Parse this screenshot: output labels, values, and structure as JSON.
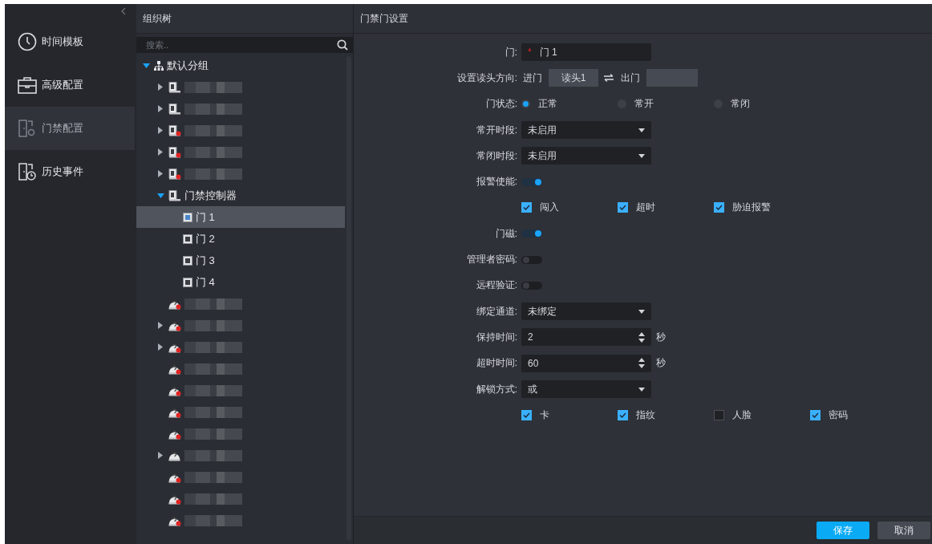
{
  "nav": {
    "items": [
      {
        "label": "时间模板",
        "selected": false
      },
      {
        "label": "高级配置",
        "selected": false
      },
      {
        "label": "门禁配置",
        "selected": true
      },
      {
        "label": "历史事件",
        "selected": false
      }
    ]
  },
  "tree": {
    "title": "组织树",
    "search": {
      "placeholder": "搜索.."
    },
    "root": {
      "label": "默认分组",
      "expanded": true,
      "children": [
        {
          "kind": "device",
          "expanded": false,
          "alarm": false
        },
        {
          "kind": "device",
          "expanded": false,
          "alarm": false
        },
        {
          "kind": "device",
          "expanded": false,
          "alarm": true
        },
        {
          "kind": "device",
          "expanded": false,
          "alarm": true
        },
        {
          "kind": "device",
          "expanded": false,
          "alarm": true
        },
        {
          "kind": "device",
          "label": "门禁控制器",
          "expanded": true,
          "alarm": false,
          "children": [
            {
              "kind": "door",
              "label": "门 1",
              "selected": true
            },
            {
              "kind": "door",
              "label": "门 2",
              "selected": false
            },
            {
              "kind": "door",
              "label": "门 3",
              "selected": false
            },
            {
              "kind": "door",
              "label": "门 4",
              "selected": false
            }
          ]
        },
        {
          "kind": "offline",
          "alarm": true
        },
        {
          "kind": "offline",
          "expanded": false,
          "alarm": true
        },
        {
          "kind": "offline",
          "expanded": false,
          "alarm": true
        },
        {
          "kind": "offline",
          "alarm": true
        },
        {
          "kind": "offline",
          "alarm": true
        },
        {
          "kind": "offline",
          "alarm": true
        },
        {
          "kind": "offline",
          "alarm": true
        },
        {
          "kind": "offline",
          "expanded": false,
          "alarm": false
        },
        {
          "kind": "offline",
          "alarm": true
        },
        {
          "kind": "offline",
          "alarm": true
        },
        {
          "kind": "offline",
          "alarm": true
        }
      ]
    }
  },
  "form": {
    "title": "门禁门设置",
    "rows": [
      {
        "kind": "text",
        "label": "门:",
        "required_mark": "*",
        "value": "门 1"
      },
      {
        "kind": "direction",
        "label": "设置读头方向:",
        "in_label": "进门",
        "in_value": "读头1",
        "out_label": "出门"
      },
      {
        "kind": "radio",
        "label": "门状态:",
        "options": [
          {
            "label": "正常",
            "selected": true
          },
          {
            "label": "常开",
            "selected": false
          },
          {
            "label": "常闭",
            "selected": false
          }
        ]
      },
      {
        "kind": "select",
        "label": "常开时段:",
        "value": "未启用"
      },
      {
        "kind": "select",
        "label": "常闭时段:",
        "value": "未启用"
      },
      {
        "kind": "toggle",
        "label": "报警使能:",
        "on": true
      },
      {
        "kind": "checks",
        "options": [
          {
            "label": "闯入",
            "checked": true
          },
          {
            "label": "超时",
            "checked": true
          },
          {
            "label": "胁迫报警",
            "checked": true
          }
        ]
      },
      {
        "kind": "toggle",
        "label": "门磁:",
        "on": true
      },
      {
        "kind": "toggle",
        "label": "管理者密码:",
        "on": false
      },
      {
        "kind": "toggle",
        "label": "远程验证:",
        "on": false
      },
      {
        "kind": "select",
        "label": "绑定通道:",
        "value": "未绑定"
      },
      {
        "kind": "number",
        "label": "保持时间:",
        "value": "2",
        "unit": "秒"
      },
      {
        "kind": "number",
        "label": "超时时间:",
        "value": "60",
        "unit": "秒"
      },
      {
        "kind": "select",
        "label": "解锁方式:",
        "value": "或"
      },
      {
        "kind": "checks",
        "options": [
          {
            "label": "卡",
            "checked": true
          },
          {
            "label": "指纹",
            "checked": true
          },
          {
            "label": "人脸",
            "checked": false
          },
          {
            "label": "密码",
            "checked": true
          }
        ]
      }
    ]
  },
  "buttons": [
    {
      "kind": "primary",
      "label": "保存"
    },
    {
      "kind": "secondary",
      "label": "取消"
    }
  ]
}
